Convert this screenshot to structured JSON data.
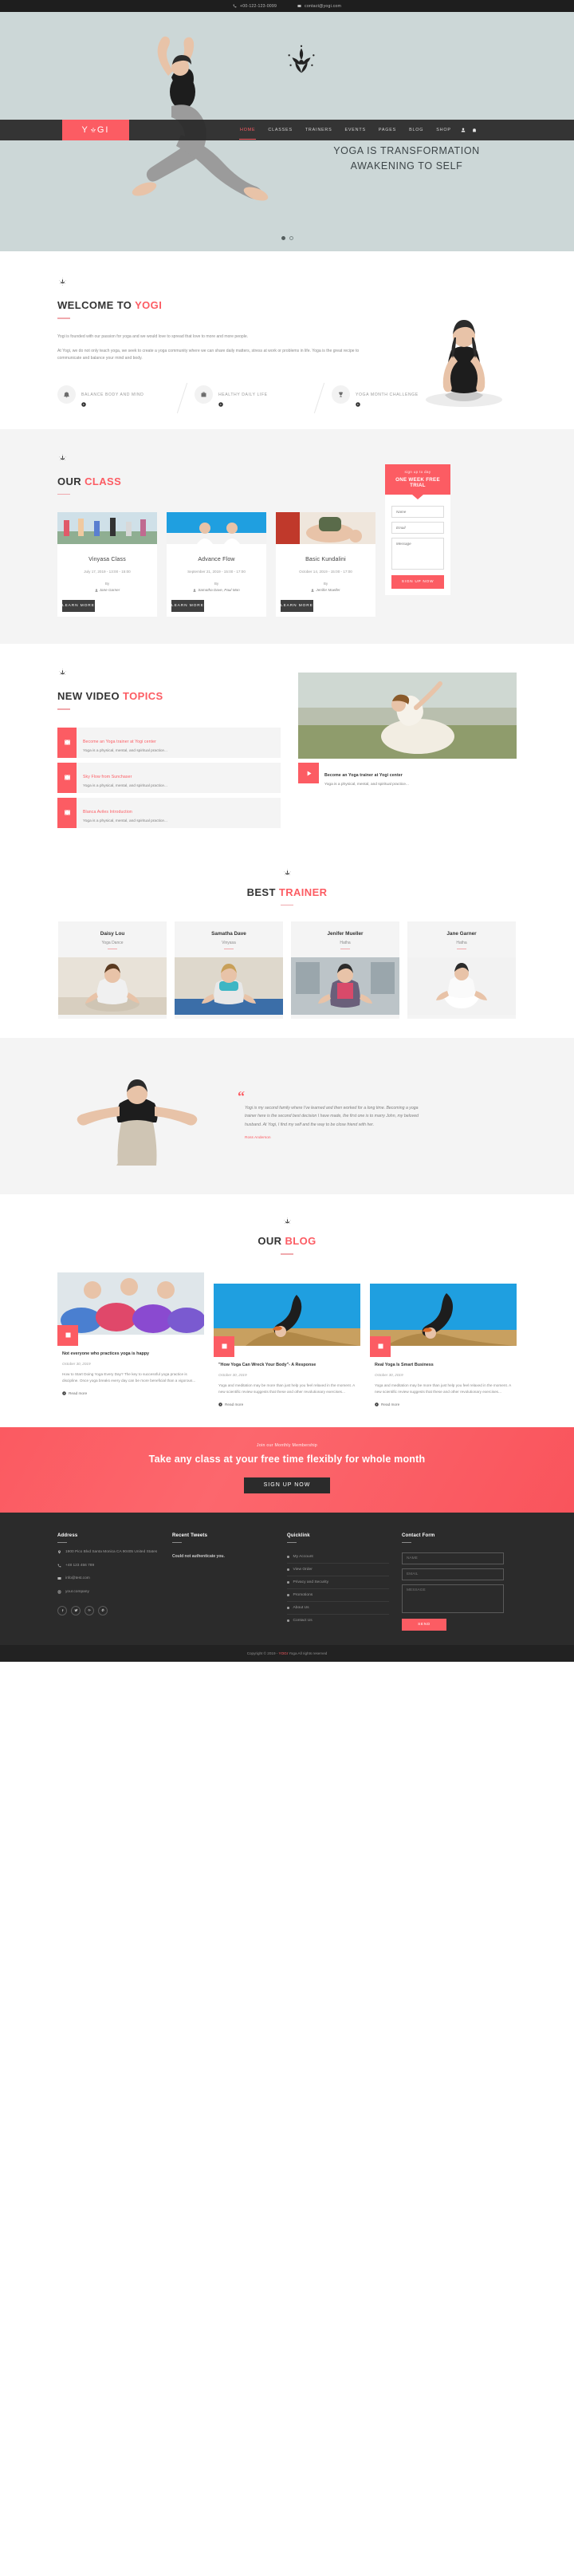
{
  "topbar": {
    "phone": "+00-122-123-0099",
    "email": "contact@yogi.com"
  },
  "nav": {
    "logo": "YOGI",
    "items": [
      {
        "label": "HOME",
        "active": true
      },
      {
        "label": "CLASSES",
        "active": false
      },
      {
        "label": "TRAINERS",
        "active": false
      },
      {
        "label": "EVENTS",
        "active": false
      },
      {
        "label": "PAGES",
        "active": false
      },
      {
        "label": "BLOG",
        "active": false
      },
      {
        "label": "SHOP",
        "active": false
      }
    ]
  },
  "hero": {
    "line1": "YOGA IS TRANSFORMATION",
    "line2": "AWAKENING TO SELF"
  },
  "welcome": {
    "title_main": "WELCOME TO ",
    "title_accent": "YOGI",
    "paragraph1": "Yogi is founded with our passion for yoga and we would love to spread that love to more and more people.",
    "paragraph2": "At Yogi, we do not only teach yoga, we seek to create a yoga community where we can share daily matters, stress at work or problems in life. Yoga is the great recipe to communicate and balance your mind and body.",
    "features": [
      {
        "label": "BALANCE BODY AND MIND",
        "icon": "bell-icon"
      },
      {
        "label": "HEALTHY DAILY LIFE",
        "icon": "briefcase-icon"
      },
      {
        "label": "YOGA MONTH CHALLENGE",
        "icon": "trophy-icon"
      }
    ]
  },
  "classes": {
    "title_main": "OUR ",
    "title_accent": "CLASS",
    "items": [
      {
        "name": "Vinyasa Class",
        "date": "July 17, 2019 - 13:00 - 15:00",
        "by_label": "By",
        "author": "Jane Garner",
        "button": "LEARN MORE"
      },
      {
        "name": "Advance Flow",
        "date": "September 21, 2019 - 15:00 - 17:00",
        "by_label": "By",
        "author": "Samatha Dave, Paul Man",
        "button": "LEARN MORE"
      },
      {
        "name": "Basic Kundalini",
        "date": "October 14, 2019 - 15:00 - 17:00",
        "by_label": "By",
        "author": "Jenifer Mueller",
        "button": "LEARN MORE"
      }
    ],
    "trial": {
      "subtitle": "sign up to day",
      "title": "ONE WEEK FREE TRIAL",
      "name_placeholder": "Name",
      "email_placeholder": "Email",
      "message_placeholder": "Message",
      "submit": "SIGN UP NOW"
    }
  },
  "videos": {
    "title_main": "NEW VIDEO ",
    "title_accent": "TOPICS",
    "items": [
      {
        "title": "Become an Yoga trainer at Yogi center",
        "desc": "Yoga is a physical, mental, and spiritual practice..."
      },
      {
        "title": "Sky Flow from Sunchaser",
        "desc": "Yoga is a physical, mental, and spiritual practice..."
      },
      {
        "title": "Blanca Aviles Introduction",
        "desc": "Yoga is a physical, mental, and spiritual practice..."
      }
    ],
    "featured": {
      "title": "Become an Yoga trainer at Yogi center",
      "desc": "Yoga is a physical, mental, and spiritual practice..."
    }
  },
  "trainers": {
    "title_main": "BEST ",
    "title_accent": "TRAINER",
    "items": [
      {
        "name": "Daisy Lou",
        "role": "Yoga Dance"
      },
      {
        "name": "Samatha Dave",
        "role": "Vinyasa"
      },
      {
        "name": "Jenifer Mueller",
        "role": "Hatha"
      },
      {
        "name": "Jane Garner",
        "role": "Hatha"
      }
    ]
  },
  "testimonial": {
    "quote": "Yogi is my second family where I've learned and then worked for a long time. Becoming a yoga trainer here is the second best decision I have made, the first one is to marry John, my beloved husband. At Yogi, I find my self and the way to be close friend with her.",
    "author": "Ross Anderson"
  },
  "blog": {
    "title_main": "OUR ",
    "title_accent": "BLOG",
    "posts": [
      {
        "title": "Not everyone who practices yoga is happy",
        "date": "October 30, 2019",
        "desc": "How to Start Doing Yoga Every Day? The key to successful yoga practice is discipline. Once yoga breaks every day can be more beneficial than a vigorous...",
        "more": "Read more"
      },
      {
        "title": "\"How Yoga Can Wreck Your Body\"- A Response",
        "date": "October 30, 2019",
        "desc": "Yoga and meditation may be more than just help you feel relaxed in the moment. A new scientific review suggests that these and other revolutionary exercises...",
        "more": "Read more"
      },
      {
        "title": "Real Yoga Is Smart Business",
        "date": "October 30, 2019",
        "desc": "Yoga and meditation may be more than just help you feel relaxed in the moment. A new scientific review suggests that these and other revolutionary exercises...",
        "more": "Read more"
      }
    ]
  },
  "cta": {
    "subtitle": "Join our Monthly Membership",
    "title": "Take any class at your free time flexibly for whole month",
    "button": "SIGN UP NOW"
  },
  "footer": {
    "address": {
      "heading": "Address",
      "street": "1900 Pico Blvd Santa Monica CA 90405 United States",
      "phone": "+48 123 456 789",
      "email": "info@test.com",
      "site": "your.company",
      "socials": [
        "facebook-icon",
        "twitter-icon",
        "google-plus-icon",
        "pinterest-icon"
      ]
    },
    "tweets": {
      "heading": "Recent Tweets",
      "message": "Could not authenticate you."
    },
    "quicklink": {
      "heading": "Quicklink",
      "items": [
        "My Account",
        "View Order",
        "Privacy and Security",
        "Promotions",
        "About Us",
        "Contact Us"
      ]
    },
    "contact": {
      "heading": "Contact Form",
      "name_placeholder": "NAME",
      "email_placeholder": "EMAIL",
      "message_placeholder": "MESSAGE",
      "submit": "SEND"
    },
    "copyright_left": "Copyright © 2019 - ",
    "copyright_accent": "YOGI",
    "copyright_right": " Yoga All rights reserved"
  },
  "colors": {
    "accent": "#fc5c63",
    "dark": "#2b2b2b",
    "hero_bg": "#ccd7d7"
  }
}
